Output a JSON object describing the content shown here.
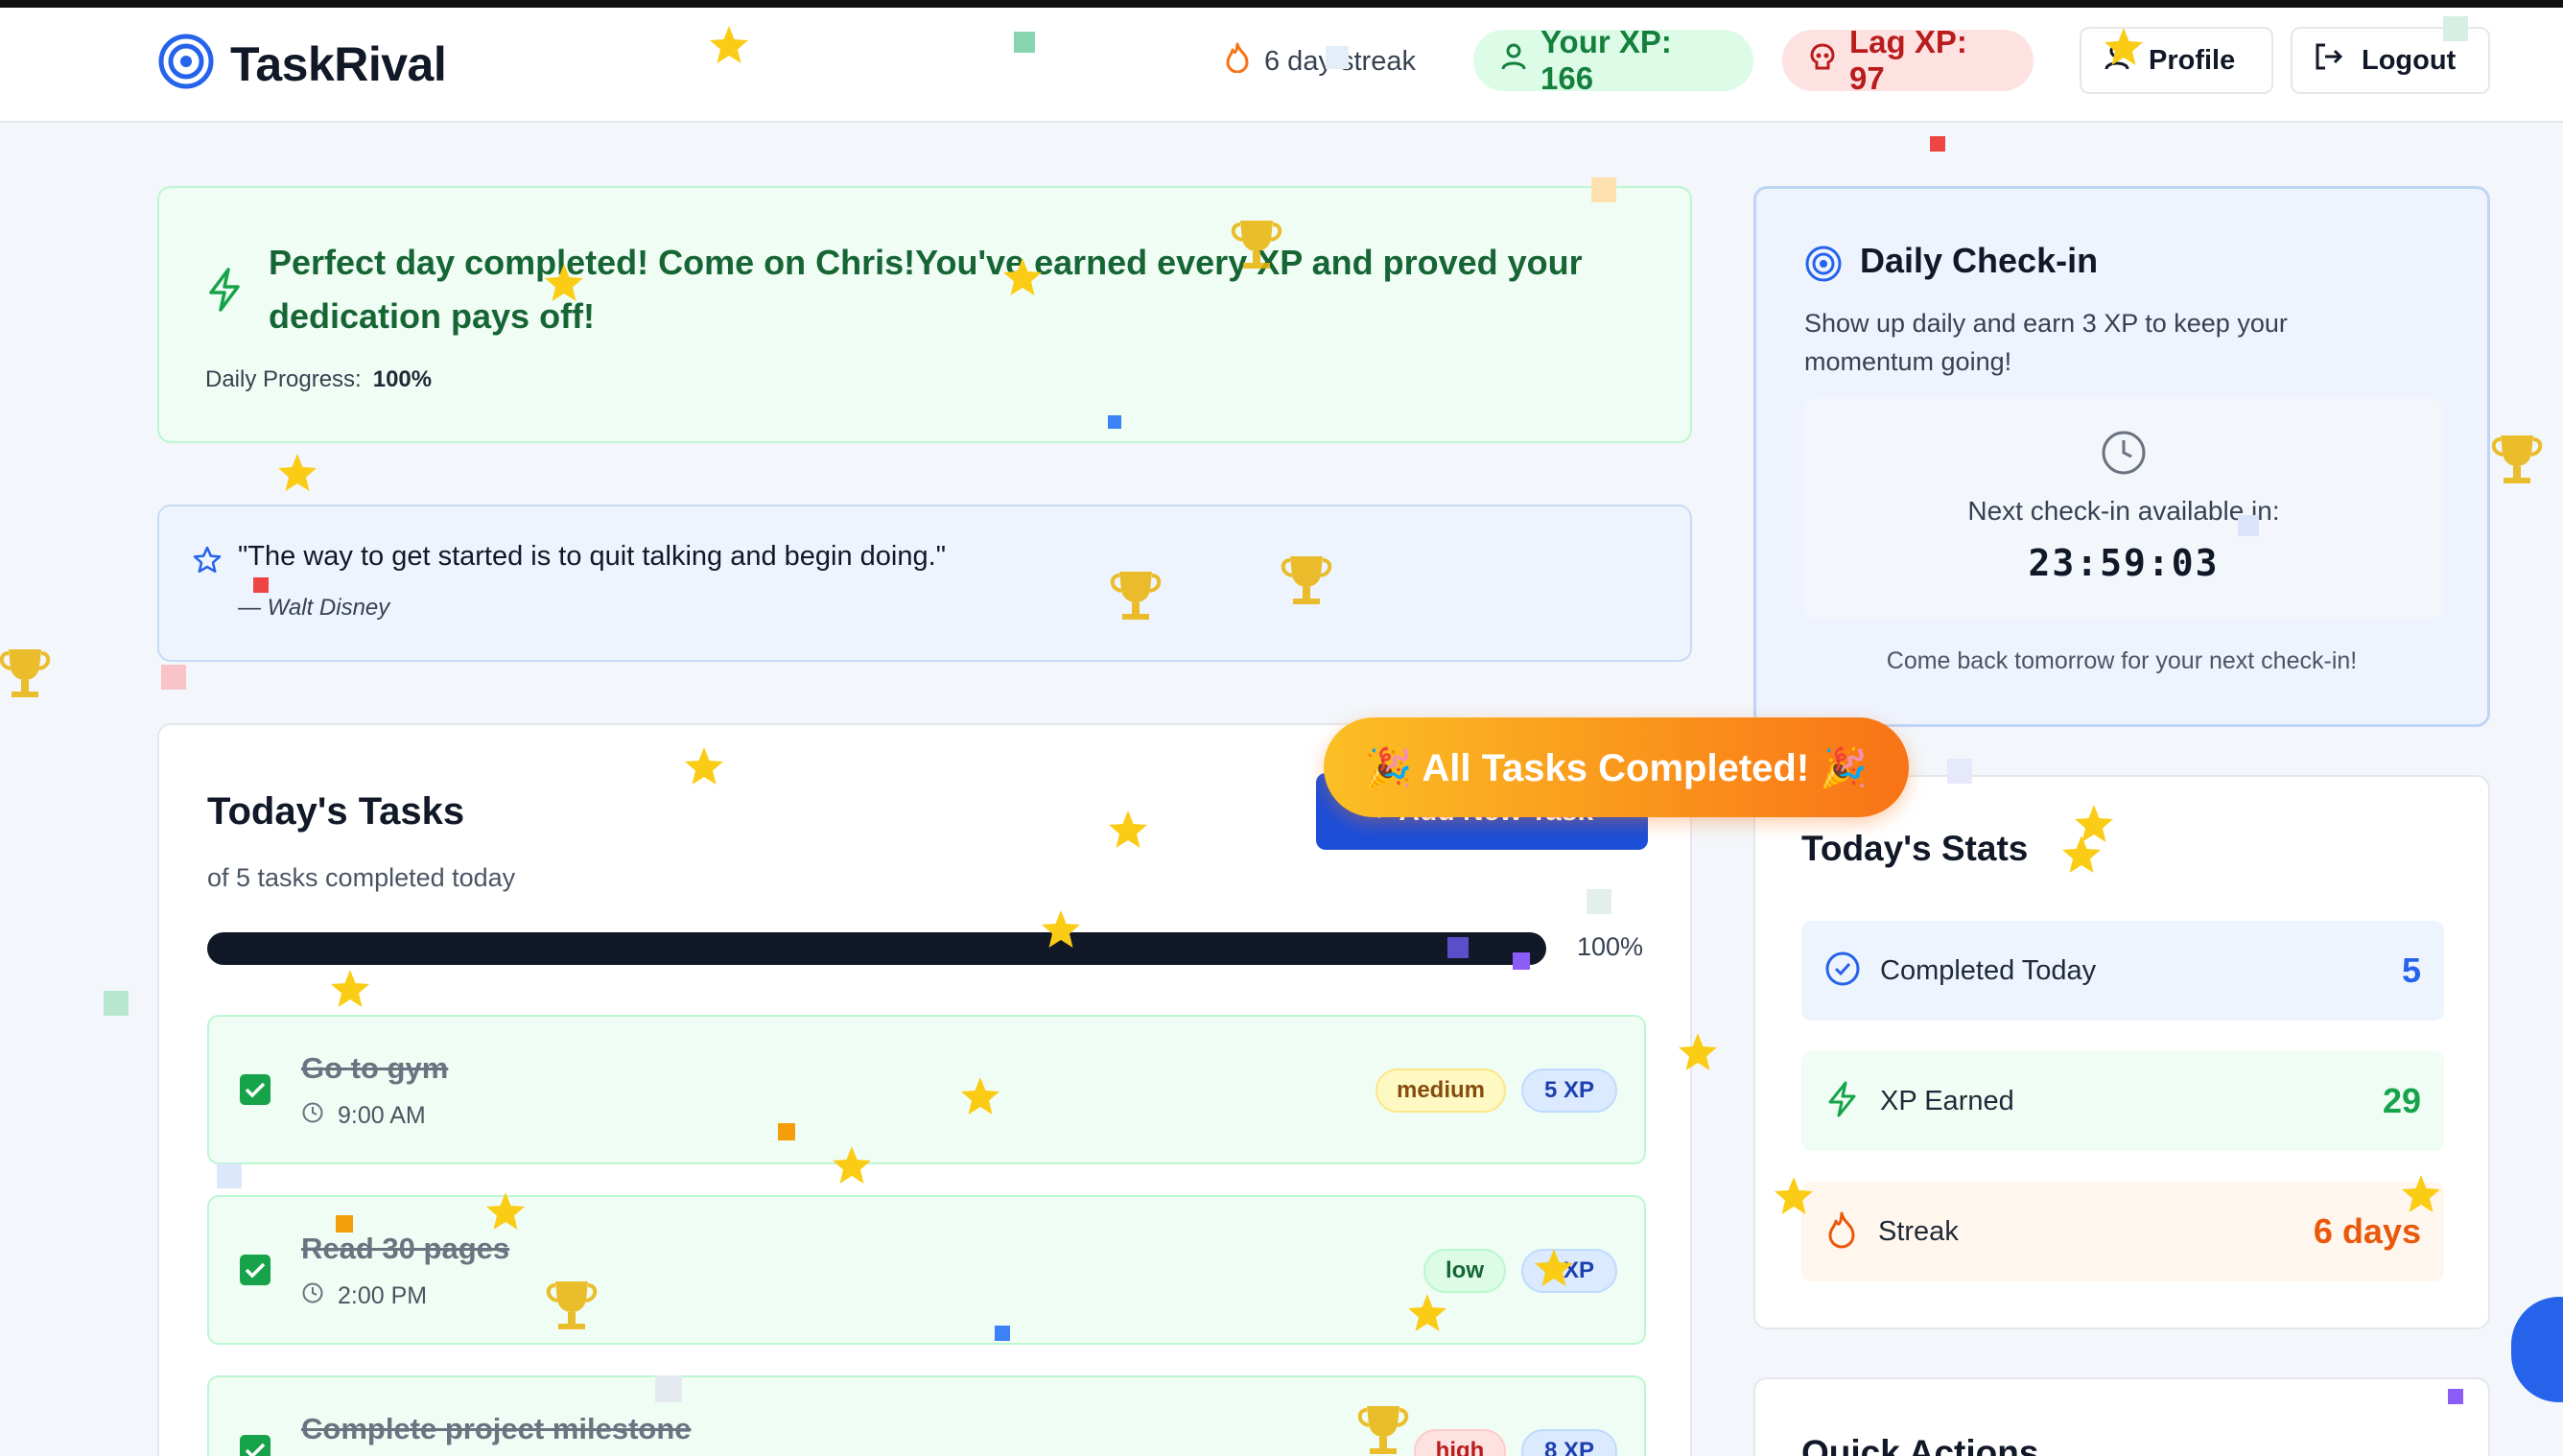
{
  "app": {
    "title": "TaskRival"
  },
  "header": {
    "streak": "6 day streak",
    "your_xp": "Your XP: 166",
    "lag_xp": "Lag XP: 97",
    "profile_label": "Profile",
    "logout_label": "Logout"
  },
  "success": {
    "message": "Perfect day completed! Come on Chris!You've earned every XP and proved your dedication pays off!",
    "progress_label": "Daily Progress:",
    "progress_value": "100%",
    "progress_fraction": 1.0
  },
  "quote": {
    "text": "\"The way to get started is to quit talking and begin doing.\"",
    "author": "— Walt Disney"
  },
  "tasks": {
    "title": "Today's Tasks",
    "subtitle": "of 5 tasks completed today",
    "add_label": "Add New Task",
    "progress_value": "100%",
    "progress_fraction": 1.0,
    "items": [
      {
        "name": "Go to gym",
        "time": "9:00 AM",
        "priority": "medium",
        "xp": "5 XP",
        "completed": true
      },
      {
        "name": "Read 30 pages",
        "time": "2:00 PM",
        "priority": "low",
        "xp": "3 XP",
        "completed": true
      },
      {
        "name": "Complete project milestone",
        "time": "",
        "priority": "high",
        "xp": "8 XP",
        "completed": true
      }
    ]
  },
  "toast": {
    "text": "🎉 All Tasks Completed! 🎉"
  },
  "checkin": {
    "title": "Daily Check-in",
    "description": "Show up daily and earn 3 XP to keep your momentum going!",
    "next_label": "Next check-in available in:",
    "timer": "23:59:03",
    "footer": "Come back tomorrow for your next check-in!"
  },
  "stats": {
    "title": "Today's Stats",
    "items": [
      {
        "label": "Completed Today",
        "value": "5",
        "color": "#2563eb"
      },
      {
        "label": "XP Earned",
        "value": "29",
        "color": "#16a34a"
      },
      {
        "label": "Streak",
        "value": "6 days",
        "color": "#ea580c"
      }
    ]
  },
  "quick_actions": {
    "title": "Quick Actions"
  },
  "colors": {
    "accent_blue": "#2563eb",
    "success_green": "#16a34a",
    "danger_red": "#b91c1c",
    "streak_orange": "#ea580c",
    "confetti_gold": "#facc15"
  }
}
